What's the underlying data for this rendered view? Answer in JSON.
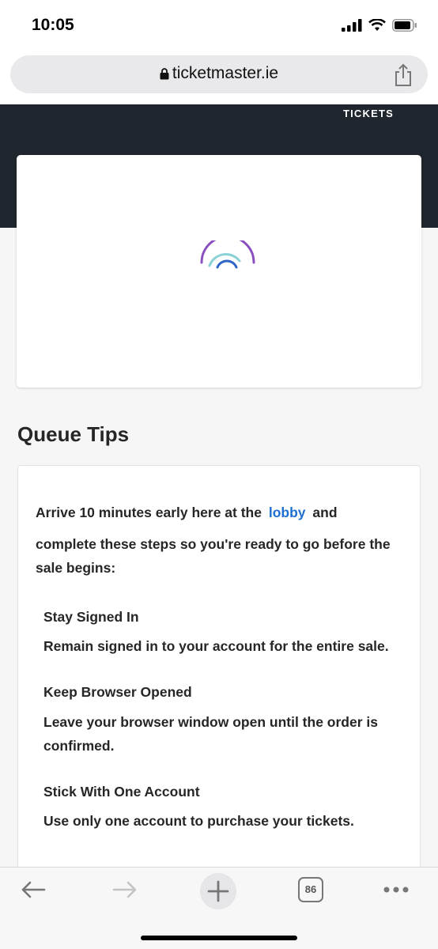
{
  "status_bar": {
    "time": "10:05"
  },
  "browser": {
    "url": "ticketmaster.ie",
    "tab_count": "86"
  },
  "hero": {
    "link_label": "TICKETS"
  },
  "queue_tips": {
    "heading": "Queue Tips",
    "intro_before": "Arrive 10 minutes early here at the",
    "lobby_link": "lobby",
    "intro_after": "and",
    "intro_line2": "complete these steps so you're ready to go before the sale begins:",
    "tips": [
      {
        "title": "Stay Signed In",
        "text": "Remain signed in to your account for the entire sale."
      },
      {
        "title": "Keep Browser Opened",
        "text": "Leave your browser window open until the order is confirmed."
      },
      {
        "title": "Stick With One Account",
        "text": "Use only one account to purchase your tickets."
      }
    ]
  },
  "colors": {
    "hero_bg": "#1f262d",
    "link": "#1f6fd1",
    "spinner_purple": "#8a4fc0",
    "spinner_teal": "#8ad1d8",
    "spinner_blue": "#2f64c8"
  }
}
